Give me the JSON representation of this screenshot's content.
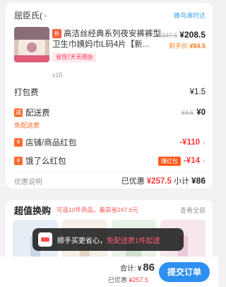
{
  "store": {
    "name": "屈臣氏(",
    "delivery_note": "蜂鸟准时达"
  },
  "product": {
    "discount_tag": "折",
    "title": "高洁丝经典系列夜安裤裤型卫生巾姨妈巾L码4片【新...",
    "promo": "省钱7天无理由",
    "quantity": "x15",
    "original_price": "¥337.5",
    "current_price": "¥208.5",
    "after_label": "到手价",
    "after_price": "¥84.5"
  },
  "packing": {
    "label": "打包费",
    "value": "¥1.5"
  },
  "delivery": {
    "badge": "减",
    "label": "配送费",
    "original": "¥4.5",
    "value": "¥0",
    "free_link": "免配送费"
  },
  "store_coupon": {
    "badge": "¥",
    "label": "店铺/商品红包",
    "value": "-¥110"
  },
  "eleme_coupon": {
    "badge": "¥",
    "label": "饿了么红包",
    "tag": "爆红包",
    "value": "-¥14"
  },
  "summary": {
    "note": "优惠说明",
    "discount_label": "已优惠",
    "discount_value": "¥257.5",
    "subtotal_label": "小计",
    "subtotal_value": "¥86"
  },
  "deals": {
    "title": "超值换购",
    "subtitle": "可选10件商品，最高省247.6元",
    "more": "查看全部"
  },
  "toast": {
    "text": "顺手买更省心，",
    "highlight": "免配送费1件起送"
  },
  "bottom": {
    "total_label": "合计:",
    "total_symbol": "¥",
    "total_value": "86",
    "discount_label": "已优惠",
    "discount_value": "¥257.5",
    "submit": "提交订单"
  },
  "colors": {
    "accent": "#2e8ff0",
    "price_red": "#ff3b3b",
    "orange": "#ff6a2c"
  }
}
